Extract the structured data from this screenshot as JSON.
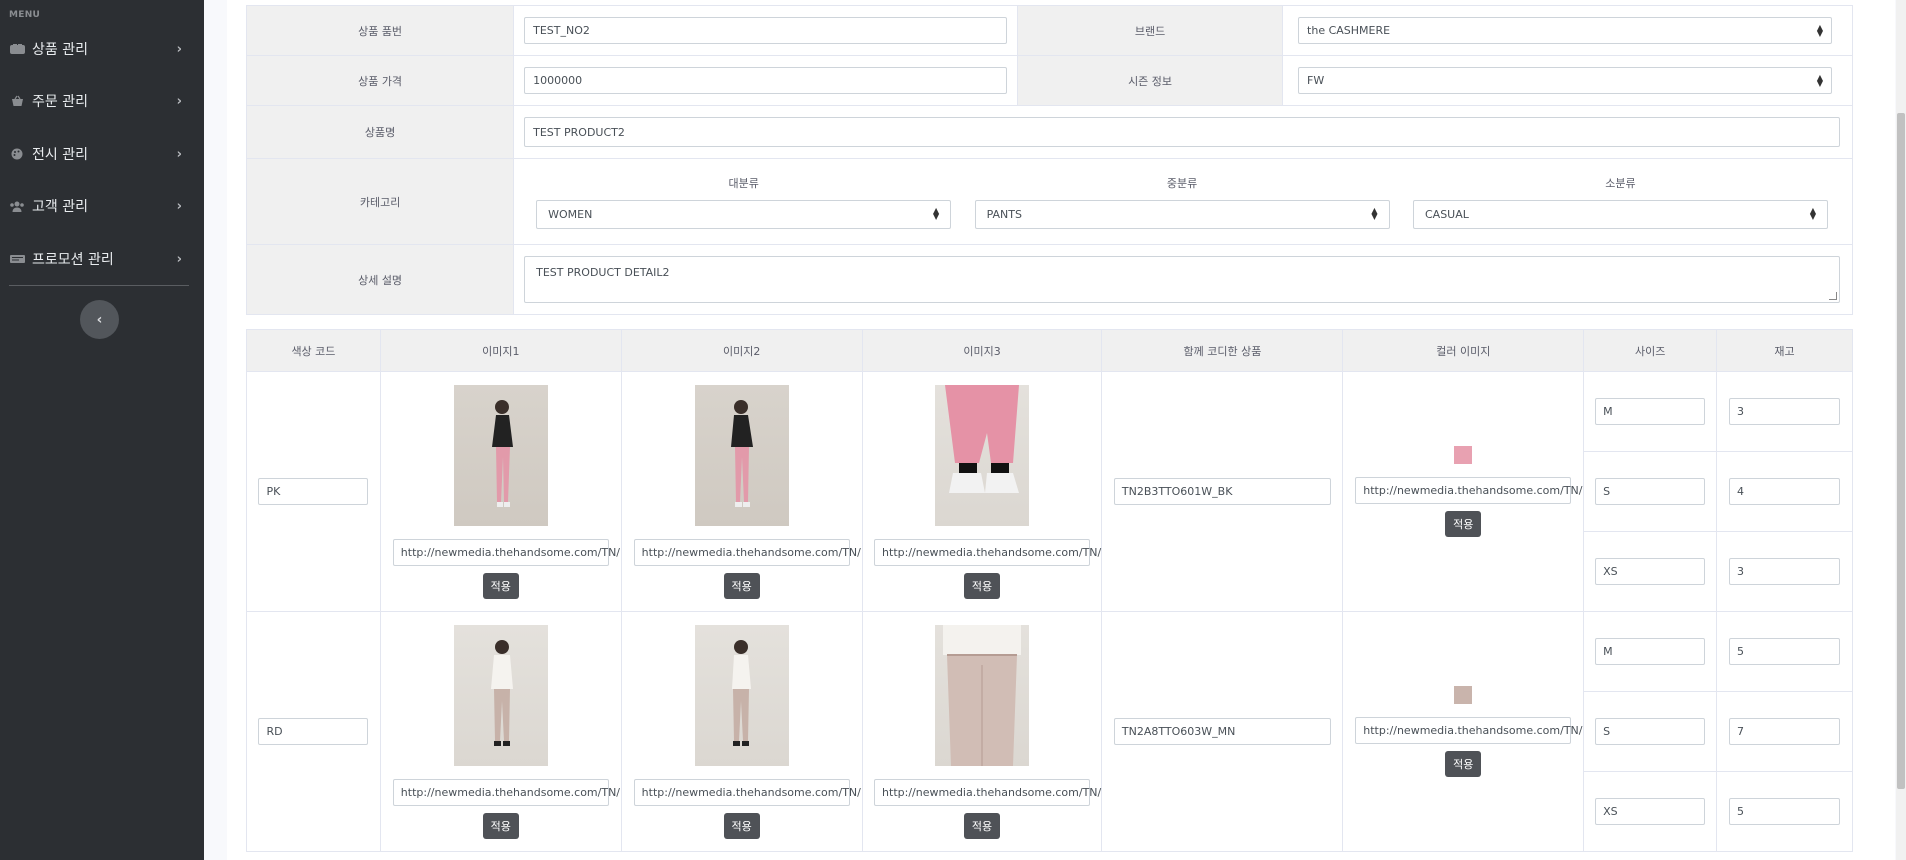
{
  "sidebar": {
    "menu_title": "MENU",
    "items": [
      {
        "label": "상품 관리",
        "icon": "products-icon"
      },
      {
        "label": "주문 관리",
        "icon": "basket-icon"
      },
      {
        "label": "전시 관리",
        "icon": "palette-icon"
      },
      {
        "label": "고객 관리",
        "icon": "users-icon"
      },
      {
        "label": "프로모션 관리",
        "icon": "ticket-icon"
      }
    ],
    "collapse_icon": "chevron-left-icon"
  },
  "product_form": {
    "code_label": "상품 품번",
    "code_value": "TEST_NO2",
    "brand_label": "브랜드",
    "brand_value": "the CASHMERE",
    "price_label": "상품 가격",
    "price_value": "1000000",
    "season_label": "시즌 정보",
    "season_value": "FW",
    "name_label": "상품명",
    "name_value": "TEST PRODUCT2",
    "category_label": "카테고리",
    "category": {
      "large_label": "대분류",
      "large_value": "WOMEN",
      "medium_label": "중분류",
      "medium_value": "PANTS",
      "small_label": "소분류",
      "small_value": "CASUAL"
    },
    "detail_label": "상세 설명",
    "detail_value": "TEST PRODUCT DETAIL2"
  },
  "options_table": {
    "headers": [
      "색상 코드",
      "이미지1",
      "이미지2",
      "이미지3",
      "함께 코디한 상품",
      "컬러 이미지",
      "사이즈",
      "재고"
    ],
    "apply_label": "적용",
    "rows": [
      {
        "color_code": "PK",
        "image1_url": "http://newmedia.thehandsome.com/TN/",
        "image2_url": "http://newmedia.thehandsome.com/TN/",
        "image3_url": "http://newmedia.thehandsome.com/TN/",
        "coordi_product": "TN2B3TTO601W_BK",
        "color_image_url": "http://newmedia.thehandsome.com/TN/",
        "swatch_color": "#e8a1b1",
        "sizes": [
          {
            "size": "M",
            "stock": "3"
          },
          {
            "size": "S",
            "stock": "4"
          },
          {
            "size": "XS",
            "stock": "3"
          }
        ]
      },
      {
        "color_code": "RD",
        "image1_url": "http://newmedia.thehandsome.com/TN/",
        "image2_url": "http://newmedia.thehandsome.com/TN/",
        "image3_url": "http://newmedia.thehandsome.com/TN/",
        "coordi_product": "TN2A8TTO603W_MN",
        "color_image_url": "http://newmedia.thehandsome.com/TN/",
        "swatch_color": "#c9b4ac",
        "sizes": [
          {
            "size": "M",
            "stock": "5"
          },
          {
            "size": "S",
            "stock": "7"
          },
          {
            "size": "XS",
            "stock": "5"
          }
        ]
      }
    ]
  }
}
